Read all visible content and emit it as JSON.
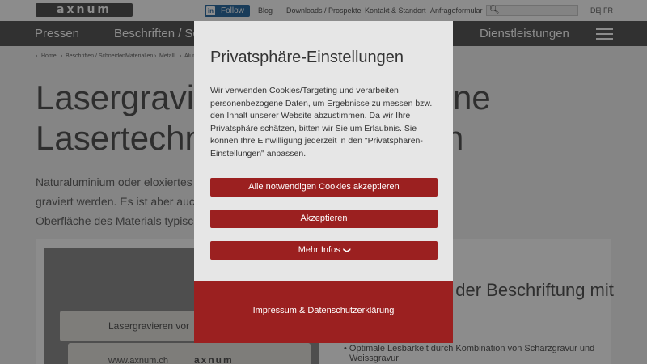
{
  "header": {
    "logo_text": "axnum",
    "follow": {
      "network": "in",
      "label": "Follow"
    },
    "links": [
      "Blog",
      "Downloads / Prospekte",
      "Kontakt & Standort",
      "Anfrageformular"
    ],
    "search": {
      "placeholder": ""
    },
    "languages": {
      "de": "DE",
      "separator": "|",
      "fr": "FR"
    }
  },
  "nav": {
    "items": [
      "Pressen",
      "Beschriften / Schneiden",
      "Dienstleistungen"
    ]
  },
  "breadcrumb": [
    "Home",
    "Beschriften / Schneiden",
    "Materialien",
    "Metall",
    "Alum"
  ],
  "page": {
    "title_lines": [
      "Lasergravieren",
      "Lasertechnik fü"
    ],
    "title_right_lines": [
      "ne",
      "n"
    ],
    "intro_lines": [
      "Naturaluminium oder eloxiertes Alum",
      "graviert werden. Es ist aber auch eine",
      "Oberfläche des Materials typischerwe"
    ],
    "photo_texts": [
      "Lasergravieren vor",
      "www.axnum.ch",
      "axnum"
    ],
    "right_heading": "le der Beschriftung mit",
    "bullet_lines": [
      "Optimale Lesbarkeit durch Kombination von Scharzgravur und",
      "Weissgravur"
    ]
  },
  "modal": {
    "title": "Privatsphäre-Einstellungen",
    "body": "Wir verwenden Cookies/Targeting und verarbeiten personenbezogene Daten, um Ergebnisse zu messen bzw. den Inhalt unserer Website abzustimmen. Da wir Ihre Privatsphäre schätzen, bitten wir Sie um Erlaubnis. Sie können Ihre Einwilligung jederzeit in den \"Privatsphären-Einstellungen\" anpassen.",
    "buttons": {
      "necessary": "Alle notwendigen Cookies akzeptieren",
      "accept": "Akzeptieren",
      "more": "Mehr Infos"
    },
    "footer_link": "Impressum & Datenschutzerklärung"
  },
  "colors": {
    "accent": "#9b2020",
    "navbar": "#5a5a5a",
    "linkedin": "#2f6ea5"
  }
}
